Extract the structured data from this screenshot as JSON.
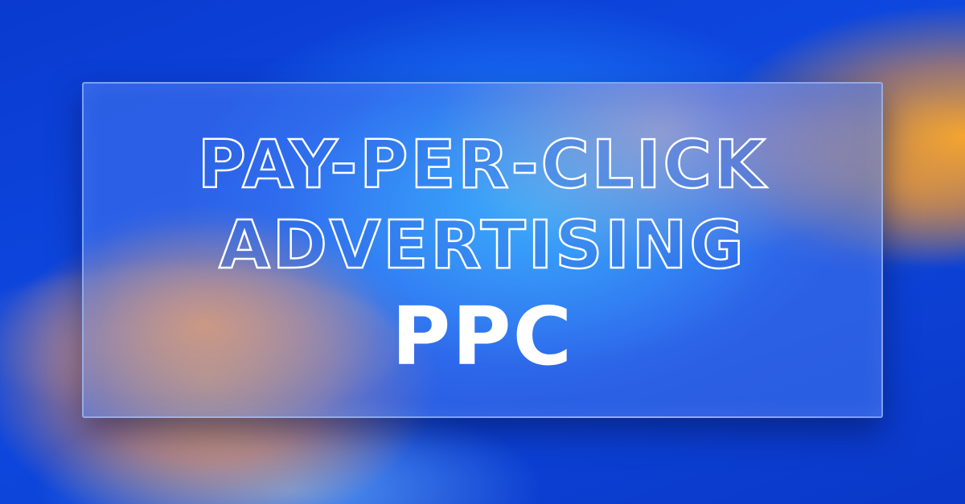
{
  "banner": {
    "title_line_1": "PAY-PER-CLICK",
    "title_line_2": "ADVERTISING",
    "acronym": "PPC"
  },
  "colors": {
    "background_blue": "#0b3fc9",
    "accent_orange": "#ffa028",
    "text_white": "#ffffff"
  }
}
